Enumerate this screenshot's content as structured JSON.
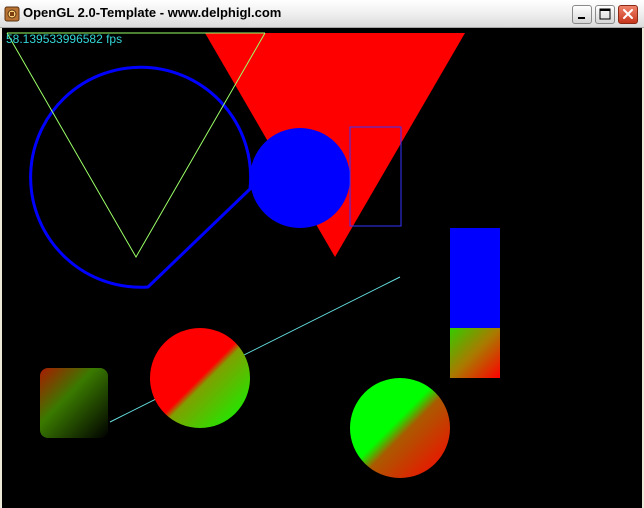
{
  "window": {
    "title": "OpenGL 2.0-Template - www.delphigl.com",
    "icon": "delphigl-app-icon",
    "controls": [
      "minimize-icon",
      "maximize-icon",
      "close-icon"
    ]
  },
  "canvas": {
    "background": "#000000",
    "fps_text": "58.139533996582 fps",
    "colors": {
      "red": "#ff0000",
      "blue": "#0000ff",
      "green": "#00ff00",
      "cyan_line": "#66e0e0",
      "fps_text": "#33d6d6",
      "yellow_green_line": "#99ff66"
    }
  }
}
